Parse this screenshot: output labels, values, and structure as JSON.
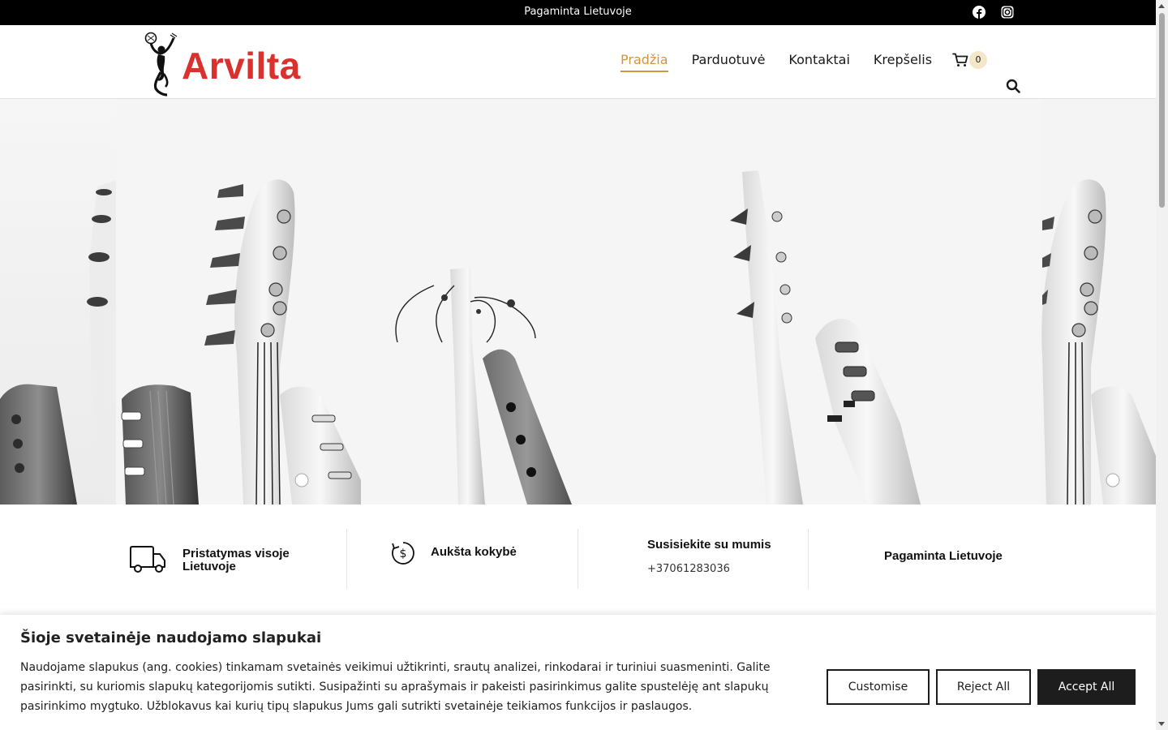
{
  "topbar": {
    "text": "Pagaminta Lietuvoje",
    "social": [
      "facebook-icon",
      "instagram-icon"
    ]
  },
  "header": {
    "logo_text": "Arvilta",
    "nav": [
      {
        "label": "Pradžia",
        "active": true
      },
      {
        "label": "Parduotuvė",
        "active": false
      },
      {
        "label": "Kontaktai",
        "active": false
      },
      {
        "label": "Krepšelis",
        "active": false
      }
    ],
    "cart_count": "0",
    "colors": {
      "brand": "#d9322e",
      "accent": "#d4933d"
    }
  },
  "hero": {
    "image": "black-and-white-guitar-headstocks"
  },
  "features": [
    {
      "title": "Pristatymas visoje Lietuvoje",
      "icon": "truck-icon"
    },
    {
      "title": "Aukšta kokybė",
      "icon": "dollar-refresh-icon"
    },
    {
      "title": "Susisiekite su mumis",
      "subtitle": "+37061283036"
    },
    {
      "title": "Pagaminta Lietuvoje"
    }
  ],
  "cookie": {
    "title": "Šioje svetainėje naudojamo slapukai",
    "text": "Naudojame slapukus (ang. cookies) tinkamam svetainės veikimui užtikrinti, srautų analizei, rinkodarai ir turiniui suasmeninti. Galite pasirinkti, su kuriomis slapukų kategorijomis sutikti. Susipažinti su aprašymais ir pakeisti pasirinkimus galite spustelėję ant slapukų pasirinkimo mygtuko. Užblokavus kai kurių tipų slapukus Jums gali sutrikti svetainėje teikiamos funkcijos ir paslaugos.",
    "buttons": {
      "customise": "Customise",
      "reject": "Reject All",
      "accept": "Accept All"
    }
  }
}
